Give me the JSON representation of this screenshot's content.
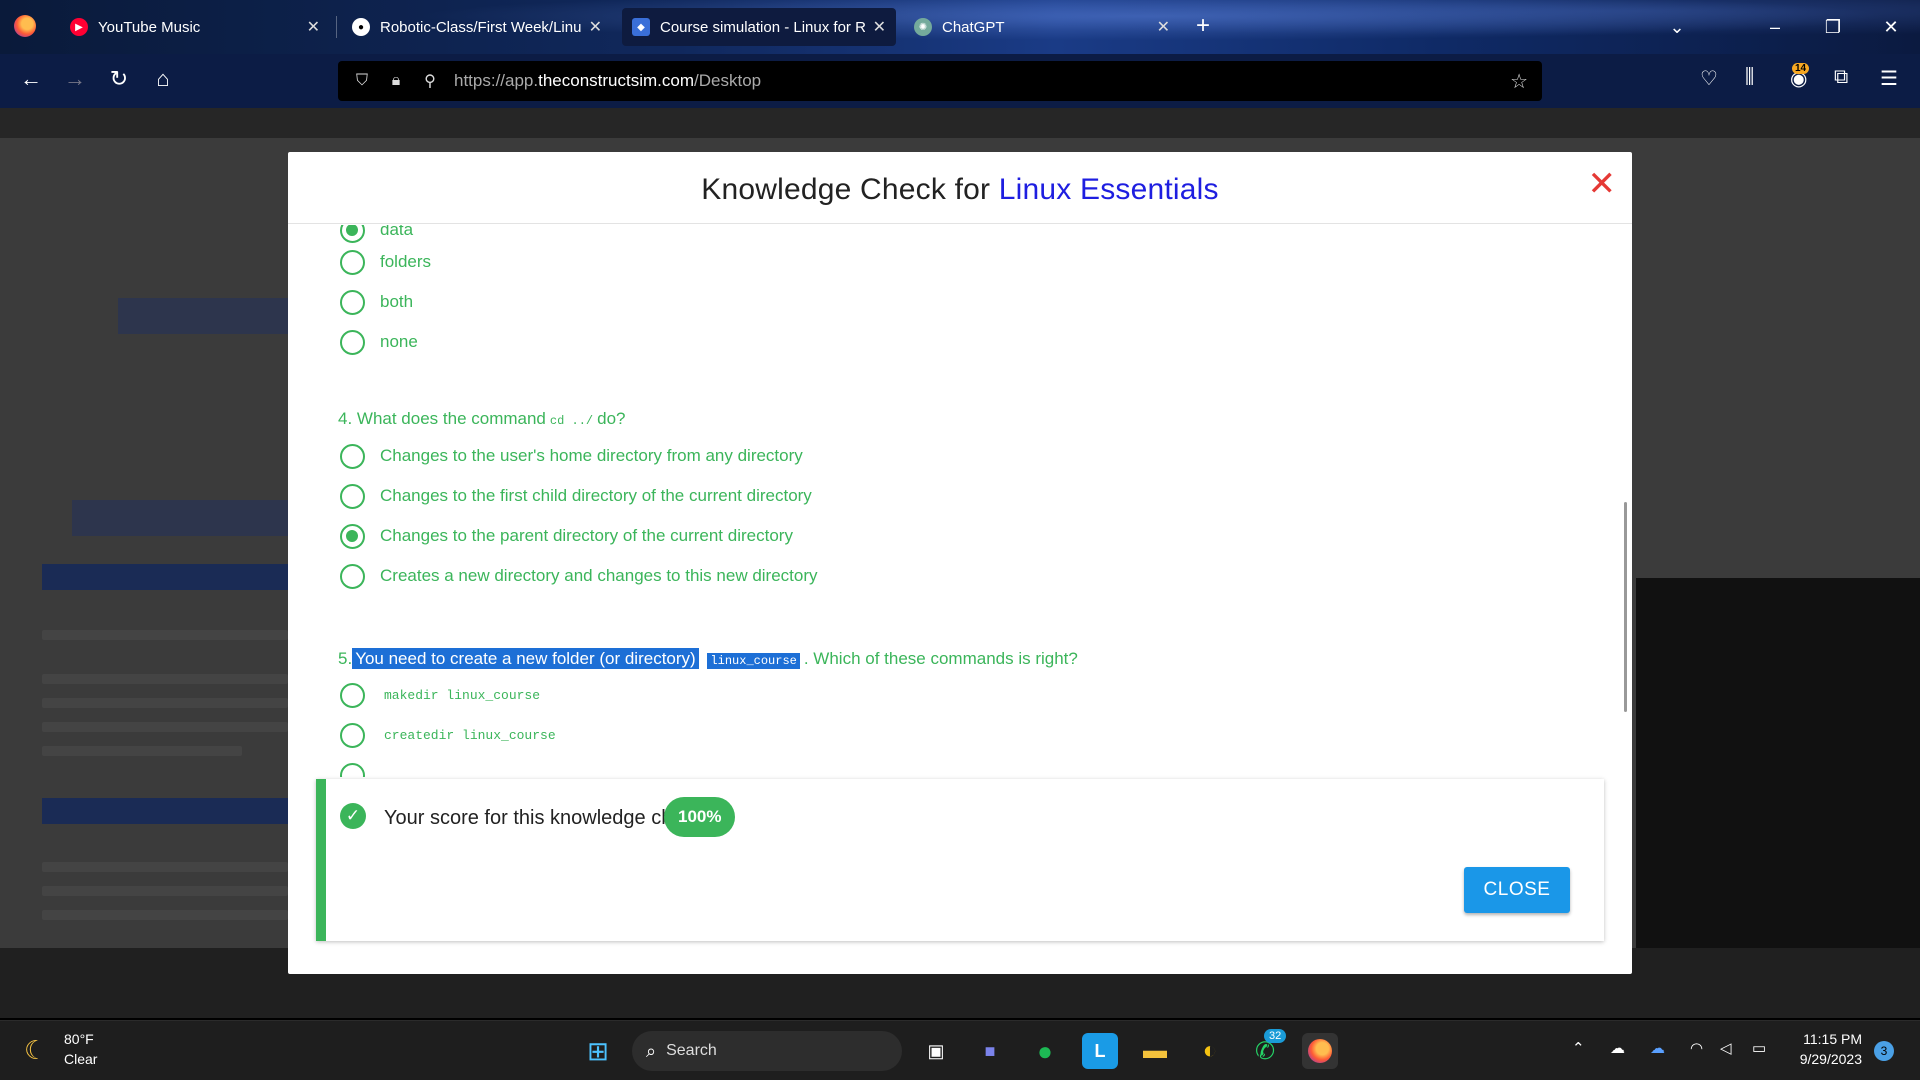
{
  "browser": {
    "tabs": [
      {
        "label": "YouTube Music",
        "close": "✕"
      },
      {
        "label": "Robotic-Class/First Week/Linux",
        "close": "✕"
      },
      {
        "label": "Course simulation - Linux for Ro",
        "close": "✕"
      },
      {
        "label": "ChatGPT",
        "close": "✕"
      }
    ],
    "new_tab": "+",
    "url_prefix": "https://app.",
    "url_domain": "theconstructsim.com",
    "url_path": "/Desktop",
    "extension_badge": "14"
  },
  "modal": {
    "title_prefix": "Knowledge Check for ",
    "title_highlight": "Linux Essentials",
    "close_glyph": "✕",
    "q3_options": [
      {
        "label": "data",
        "selected": true
      },
      {
        "label": "folders",
        "selected": false
      },
      {
        "label": "both",
        "selected": false
      },
      {
        "label": "none",
        "selected": false
      }
    ],
    "q4": {
      "prefix": "4. What does the command",
      "code": "cd ../",
      "suffix": "do?",
      "options": [
        {
          "label": "Changes to the user's home directory from any directory",
          "selected": false
        },
        {
          "label": "Changes to the first child directory of the current directory",
          "selected": false
        },
        {
          "label": "Changes to the parent directory of the current directory",
          "selected": true
        },
        {
          "label": "Creates a new directory and changes to this new directory",
          "selected": false
        }
      ]
    },
    "q5": {
      "number": "5.",
      "text": "You need to create a new folder (or directory)",
      "code": "linux_course",
      "suffix": ". Which of these commands is right?",
      "options": [
        {
          "label": "makedir linux_course",
          "selected": false
        },
        {
          "label": "createdir linux_course",
          "selected": false
        }
      ]
    },
    "score": {
      "label": "Your score for this knowledge check:",
      "value": "100%",
      "close_button": "CLOSE"
    }
  },
  "taskbar": {
    "weather_temp": "80°F",
    "weather_desc": "Clear",
    "search_label": "Search",
    "whatsapp_badge": "32",
    "time": "11:15 PM",
    "date": "9/29/2023",
    "notification_count": "3"
  },
  "colors": {
    "accent_green": "#3bb55a",
    "title_blue": "#1e1ee0",
    "close_red": "#e53935",
    "button_blue": "#1a97e8"
  }
}
